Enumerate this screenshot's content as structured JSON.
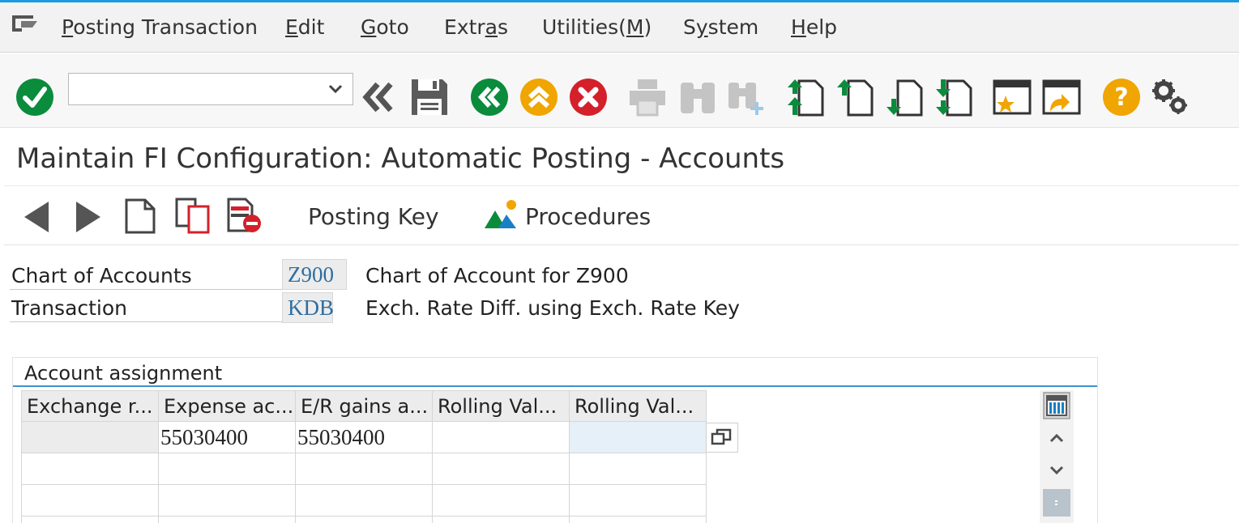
{
  "menu": {
    "items": [
      {
        "pre": "",
        "u": "P",
        "post": "osting Transaction"
      },
      {
        "pre": "",
        "u": "E",
        "post": "dit"
      },
      {
        "pre": "",
        "u": "G",
        "post": "oto"
      },
      {
        "pre": "Extr",
        "u": "a",
        "post": "s"
      },
      {
        "pre": "Utilities(",
        "u": "M",
        "post": ")"
      },
      {
        "pre": "S",
        "u": "y",
        "post": "stem"
      },
      {
        "pre": "",
        "u": "H",
        "post": "elp"
      }
    ]
  },
  "toolbar": {
    "command_field_value": "",
    "icons": [
      "enter-icon",
      "back-double-arrow-icon",
      "save-icon",
      "back-icon",
      "exit-icon",
      "cancel-icon",
      "print-icon",
      "find-icon",
      "find-next-icon",
      "first-page-icon",
      "previous-page-icon",
      "next-page-icon",
      "last-page-icon",
      "create-session-icon",
      "create-shortcut-icon",
      "help-icon",
      "settings-icon"
    ],
    "colors": {
      "green": "#0a8c3c",
      "orange": "#f0a500",
      "red": "#d4202a",
      "disabled": "#c4c4c4"
    }
  },
  "title": "Maintain FI Configuration: Automatic Posting - Accounts",
  "app_toolbar": {
    "posting_key_label": "Posting Key",
    "procedures_label": "Procedures"
  },
  "header_fields": {
    "chart_of_accounts": {
      "label": "Chart of Accounts",
      "value": "Z900",
      "description": "Chart of Account for Z900"
    },
    "transaction": {
      "label": "Transaction",
      "value": "KDB",
      "description": "Exch. Rate Diff. using Exch. Rate Key"
    }
  },
  "account_assignment": {
    "title": "Account assignment",
    "columns": [
      "Exchange r...",
      "Expense ac...",
      "E/R gains a...",
      "Rolling Val...",
      "Rolling Val..."
    ],
    "rows": [
      [
        "",
        "55030400",
        "55030400",
        "",
        ""
      ],
      [
        "",
        "",
        "",
        "",
        ""
      ],
      [
        "",
        "",
        "",
        "",
        ""
      ],
      [
        "",
        "",
        "",
        "",
        ""
      ]
    ]
  }
}
